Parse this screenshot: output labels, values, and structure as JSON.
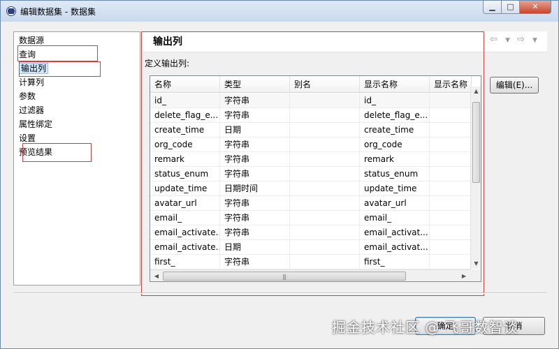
{
  "window": {
    "title": "编辑数据集 - 数据集",
    "buttons": {
      "minimize": "▁",
      "maximize": "□",
      "close": "✕"
    }
  },
  "sidebar": {
    "items": [
      {
        "label": "数据源"
      },
      {
        "label": "查询"
      },
      {
        "label": "输出列",
        "selected": true
      },
      {
        "label": "计算列"
      },
      {
        "label": "参数"
      },
      {
        "label": "过滤器"
      },
      {
        "label": "属性绑定"
      },
      {
        "label": "设置"
      },
      {
        "label": "预览结果"
      }
    ]
  },
  "page": {
    "title": "输出列",
    "define_label": "定义输出列:",
    "edit_button": "编辑(E)...",
    "nav_icons": [
      "back-arrow-icon",
      "dropdown-icon",
      "forward-arrow-icon",
      "dropdown-icon",
      "view-menu-icon"
    ]
  },
  "table": {
    "columns": [
      "名称",
      "类型",
      "别名",
      "显示名称",
      "显示名称"
    ],
    "rows": [
      [
        "id_",
        "字符串",
        "",
        "id_",
        ""
      ],
      [
        "delete_flag_e...",
        "字符串",
        "",
        "delete_flag_e...",
        ""
      ],
      [
        "create_time",
        "日期",
        "",
        "create_time",
        ""
      ],
      [
        "org_code",
        "字符串",
        "",
        "org_code",
        ""
      ],
      [
        "remark",
        "字符串",
        "",
        "remark",
        ""
      ],
      [
        "status_enum",
        "字符串",
        "",
        "status_enum",
        ""
      ],
      [
        "update_time",
        "日期时间",
        "",
        "update_time",
        ""
      ],
      [
        "avatar_url",
        "字符串",
        "",
        "avatar_url",
        ""
      ],
      [
        "email_",
        "字符串",
        "",
        "email_",
        ""
      ],
      [
        "email_activate...",
        "字符串",
        "",
        "email_activat...",
        ""
      ],
      [
        "email_activate...",
        "日期",
        "",
        "email_activat...",
        ""
      ],
      [
        "first_",
        "字符串",
        "",
        "first_",
        ""
      ]
    ]
  },
  "footer": {
    "ok_button": "确定",
    "cancel_button": "取消"
  },
  "watermark": "掘金技术社区 @ 飞哥数智谈",
  "colors": {
    "annotation_red": "#d93b3b",
    "selection": "#cde8ff"
  }
}
